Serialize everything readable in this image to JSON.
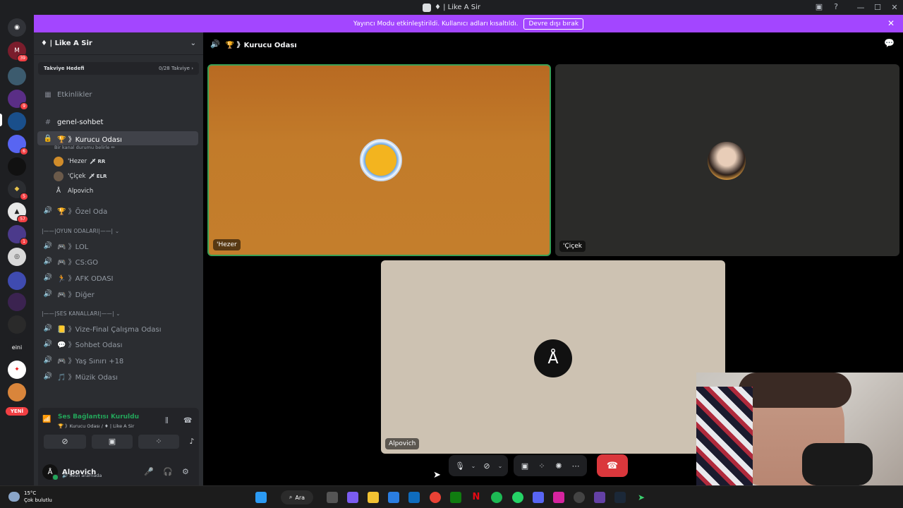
{
  "window": {
    "title": "♦ | Like A Sir"
  },
  "banner": {
    "text": "Yayıncı Modu etkinleştirildi. Kullanıcı adları kısaltıldı.",
    "button": "Devre dışı bırak"
  },
  "servers": {
    "badges": [
      "39",
      "9",
      "6",
      "5",
      "57",
      "1"
    ],
    "new_label": "YENİ",
    "text_server": "eini"
  },
  "sidebar": {
    "guild_name": "♦ | Like A Sir",
    "boost": {
      "label": "Takviye Hedefi",
      "value": "0/28 Takviye ›"
    },
    "events": "Etkinlikler",
    "channels": {
      "general": "genel-sohbet",
      "founder": "🏆 》Kurucu Odası",
      "founder_status": "Bir kanal durumu belirle ✏",
      "special": "🏆 》Özel Oda",
      "cat_games": "|——|OYUN ODALARI|——|",
      "lol": "🎮 》LOL",
      "csgo": "🎮 》CS:GO",
      "afk": "🏃 》AFK ODASI",
      "other": "🎮 》Diğer",
      "cat_voice": "|——|SES KANALLARI|——|",
      "study": "📒 》Vize-Final Çalışma Odası",
      "chat": "💬 》Sohbet Odası",
      "age": "🎮 》Yaş Sınırı +18",
      "music": "🎵 》Müzik Odası"
    },
    "voice_users": [
      {
        "name": "'Hezer",
        "tag": "🗡 RR"
      },
      {
        "name": "'Çiçek",
        "tag": "🗡 ELR"
      },
      {
        "name": "Alpovich",
        "tag": ""
      }
    ],
    "voice_panel": {
      "status": "Ses Bağlantısı Kuruldu",
      "channel": "🏆 》Kurucu Odası / ♦ | Like A Sir"
    },
    "user": {
      "name": "Alpovich",
      "status": "🔊 Sesli aramada"
    }
  },
  "call": {
    "channel_title": "🏆 》Kurucu Odası",
    "tiles": [
      {
        "name": "'Hezer"
      },
      {
        "name": "'Çiçek"
      },
      {
        "name": "Alpovich"
      }
    ]
  },
  "taskbar": {
    "weather_temp": "15°C",
    "weather_desc": "Çok bulutlu",
    "search": "Ara"
  },
  "colors": {
    "accent": "#a346ff",
    "speaking": "#3aa055",
    "connected": "#23a55a",
    "end_call": "#da373c"
  }
}
